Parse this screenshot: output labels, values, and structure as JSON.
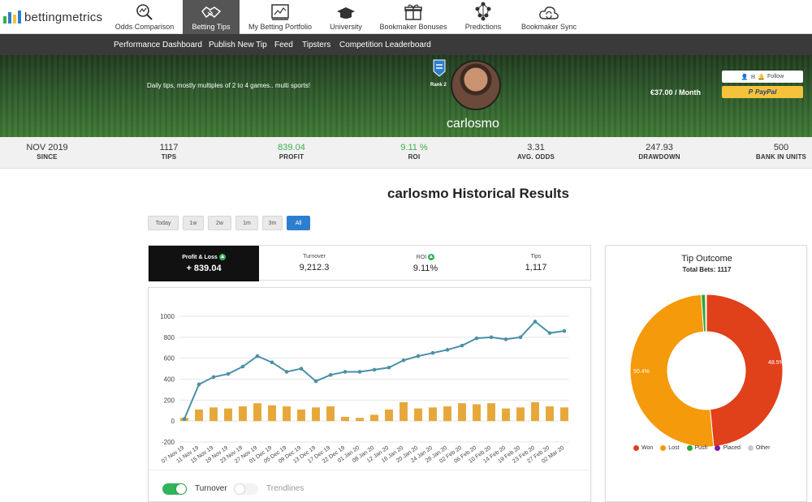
{
  "brand": {
    "name": "bettingmetrics"
  },
  "nav": {
    "items": [
      {
        "label": "Odds Comparison",
        "icon": "magnifier-chart-icon"
      },
      {
        "label": "Betting Tips",
        "icon": "handshake-icon",
        "active": true
      },
      {
        "label": "My Betting Portfolio",
        "icon": "portfolio-chart-icon"
      },
      {
        "label": "University",
        "icon": "graduation-cap-icon"
      },
      {
        "label": "Bookmaker Bonuses",
        "icon": "gift-icon"
      },
      {
        "label": "Predictions",
        "icon": "network-brain-icon"
      },
      {
        "label": "Bookmaker Sync",
        "icon": "cloud-sync-icon"
      }
    ]
  },
  "subnav": [
    "Performance Dashboard",
    "Publish New Tip",
    "Feed",
    "Tipsters",
    "Competition Leaderboard"
  ],
  "profile": {
    "description": "Daily tips, mostly multiples of 2 to 4 games.. multi sports!",
    "rank": "Rank 2",
    "username": "carlosmo",
    "price": "€37.00 / Month",
    "follow_label": "Follow",
    "paypal_label": "PayPal"
  },
  "stats": [
    {
      "value": "NOV 2019",
      "label": "SINCE"
    },
    {
      "value": "1117",
      "label": "TIPS"
    },
    {
      "value": "839.04",
      "label": "PROFIT",
      "green": true
    },
    {
      "value": "9.11 %",
      "label": "ROI",
      "green": true
    },
    {
      "value": "3.31",
      "label": "AVG. ODDS"
    },
    {
      "value": "247.93",
      "label": "DRAWDOWN"
    },
    {
      "value": "500",
      "label": "BANK IN UNITS"
    }
  ],
  "page_title": "carlosmo Historical Results",
  "timeframes": [
    "Today",
    "1w",
    "2w",
    "1m",
    "3m",
    "All"
  ],
  "active_timeframe": "All",
  "summary": [
    {
      "label": "Profit & Loss",
      "value": "+ 839.04",
      "arrow": true,
      "dark": true
    },
    {
      "label": "Turnover",
      "value": "9,212.3"
    },
    {
      "label": "ROI",
      "value": "9.11%",
      "arrow": true
    },
    {
      "label": "Tips",
      "value": "1,117"
    }
  ],
  "toggles": [
    {
      "label": "Turnover",
      "on": true
    },
    {
      "label": "Trendlines",
      "on": false
    }
  ],
  "outcome": {
    "title": "Tip Outcome",
    "total_label": "Total Bets: 1117"
  },
  "colors": {
    "line": "#4a90a8",
    "bars": "#e6a83a",
    "won": "#e0401a",
    "lost": "#f59a0a",
    "push": "#2ea43b",
    "placed": "#7b1fa2",
    "other": "#cccccc",
    "accent": "#2c7fcf"
  },
  "chart_data": [
    {
      "type": "line",
      "yticks": [
        "1000",
        "800",
        "600",
        "400",
        "200",
        "0",
        "-200"
      ],
      "ylim": [
        -200,
        1000
      ],
      "grid": true,
      "x": [
        "07 Nov 19",
        "11 Nov 19",
        "15 Nov 19",
        "19 Nov 19",
        "23 Nov 19",
        "27 Nov 19",
        "01 Dec 19",
        "05 Dec 19",
        "09 Dec 19",
        "13 Dec 19",
        "17 Dec 19",
        "22 Dec 19",
        "01 Jan 20",
        "08 Jan 20",
        "12 Jan 20",
        "16 Jan 20",
        "20 Jan 20",
        "24 Jan 20",
        "28 Jan 20",
        "02 Feb 20",
        "06 Feb 20",
        "10 Feb 20",
        "14 Feb 20",
        "19 Feb 20",
        "23 Feb 20",
        "27 Feb 20",
        "02 Mar 20"
      ],
      "series": [
        {
          "values": [
            20,
            350,
            420,
            450,
            520,
            620,
            560,
            470,
            500,
            380,
            440,
            470,
            470,
            490,
            510,
            580,
            620,
            650,
            680,
            720,
            790,
            800,
            780,
            800,
            950,
            840,
            860
          ]
        },
        {
          "values": [
            30,
            110,
            130,
            120,
            140,
            170,
            150,
            140,
            110,
            130,
            140,
            40,
            30,
            60,
            110,
            180,
            120,
            130,
            140,
            170,
            160,
            170,
            120,
            130,
            180,
            140,
            130
          ]
        }
      ]
    },
    {
      "type": "pie",
      "categories": [
        "Won",
        "Lost",
        "Push",
        "Placed",
        "Other"
      ],
      "values": [
        48.5,
        50.4,
        0.9,
        0.1,
        0.1
      ],
      "labels": [
        "48.5%",
        "50.4%"
      ],
      "legend": "bottom"
    }
  ]
}
